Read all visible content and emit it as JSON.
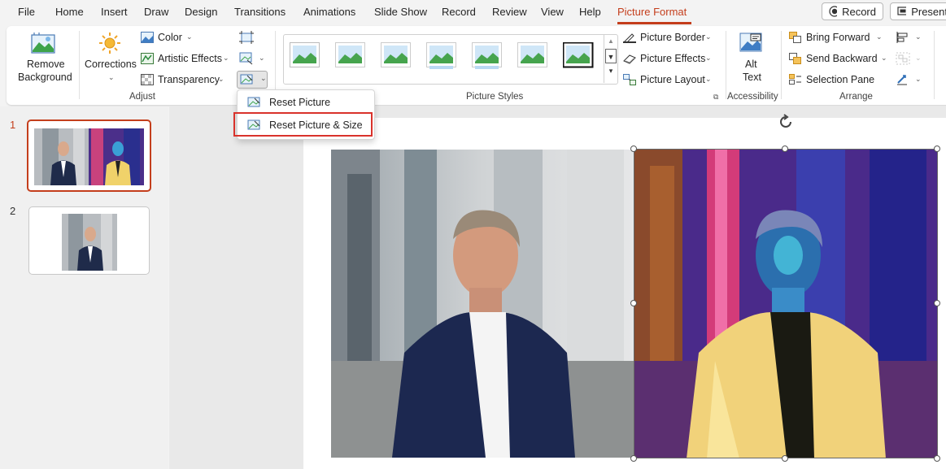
{
  "menu": {
    "tabs": [
      "File",
      "Home",
      "Insert",
      "Draw",
      "Design",
      "Transitions",
      "Animations",
      "Slide Show",
      "Record",
      "Review",
      "View",
      "Help",
      "Picture Format"
    ],
    "active_tab": "Picture Format",
    "record_button": "Record",
    "present_button": "Present"
  },
  "ribbon": {
    "adjust": {
      "remove_background": [
        "Remove",
        "Background"
      ],
      "corrections": "Corrections",
      "color": "Color",
      "artistic_effects": "Artistic Effects",
      "transparency": "Transparency",
      "group_label": "Adjust"
    },
    "picture_styles": {
      "group_label": "Picture Styles",
      "picture_border": "Picture Border",
      "picture_effects": "Picture Effects",
      "picture_layout": "Picture Layout"
    },
    "accessibility": {
      "alt_text": [
        "Alt",
        "Text"
      ],
      "group_label": "Accessibility"
    },
    "arrange": {
      "bring_forward": "Bring Forward",
      "send_backward": "Send Backward",
      "selection_pane": "Selection Pane",
      "group_label": "Arrange"
    }
  },
  "dropdown": {
    "items": [
      "Reset Picture",
      "Reset Picture & Size"
    ],
    "highlighted": "Reset Picture & Size"
  },
  "slides": {
    "numbers": [
      "1",
      "2"
    ],
    "selected": "1"
  },
  "colors": {
    "accent": "#c43e1c",
    "highlight_box": "#d9322b"
  }
}
